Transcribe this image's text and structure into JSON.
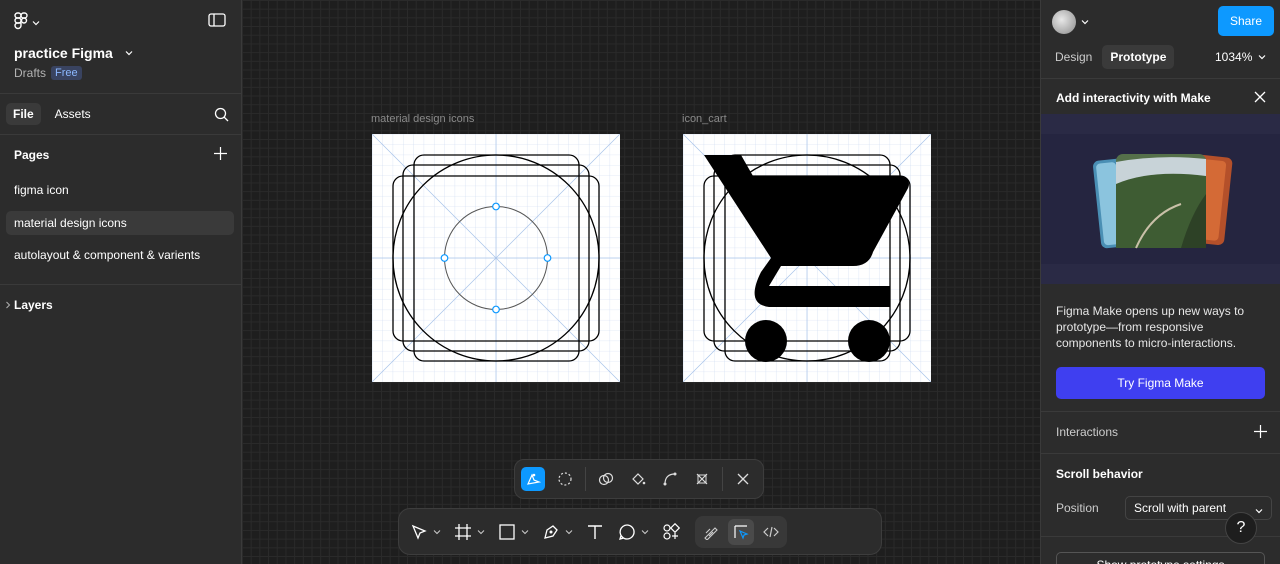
{
  "left_panel": {
    "file_name": "practice Figma",
    "location": "Drafts",
    "plan_badge": "Free",
    "tabs": [
      "File",
      "Assets"
    ],
    "pages_heading": "Pages",
    "pages": [
      {
        "label": "figma icon",
        "selected": false
      },
      {
        "label": "material design icons",
        "selected": true
      },
      {
        "label": "autolayout & component & varients",
        "selected": false
      }
    ],
    "layers_heading": "Layers",
    "icons": [
      "figma-logo-icon",
      "chevron-down-icon",
      "sidebar-toggle-icon",
      "search-icon",
      "plus-icon",
      "chevron-right-icon"
    ]
  },
  "canvas": {
    "frames": [
      {
        "label": "material design icons"
      },
      {
        "label": "icon_cart"
      }
    ],
    "sub_toolbar_icons": [
      "interaction-icon",
      "lasso-icon",
      "boolean-icon",
      "paint-bucket-icon",
      "bend-icon",
      "shape-builder-icon",
      "close-icon"
    ],
    "main_toolbar_icons": [
      "move-icon",
      "frame-icon",
      "rectangle-icon",
      "pen-icon",
      "text-icon",
      "comment-icon",
      "actions-icon"
    ],
    "mode_icons": [
      "draw-mode-icon",
      "design-mode-icon",
      "dev-mode-icon"
    ]
  },
  "right_panel": {
    "share_label": "Share",
    "tabs": [
      "Design",
      "Prototype"
    ],
    "active_tab": "Prototype",
    "zoom": "1034%",
    "promo": {
      "title": "Add interactivity with Make",
      "body": "Figma Make opens up new ways to prototype—from responsive components to micro-interactions.",
      "button": "Try Figma Make"
    },
    "interactions_label": "Interactions",
    "scroll_heading": "Scroll behavior",
    "position_label": "Position",
    "position_value": "Scroll with parent",
    "help_label": "?",
    "bottom_button": "Show prototype settings",
    "colors": {
      "accent": "#0d99ff",
      "make": "#3f3ff0"
    }
  }
}
